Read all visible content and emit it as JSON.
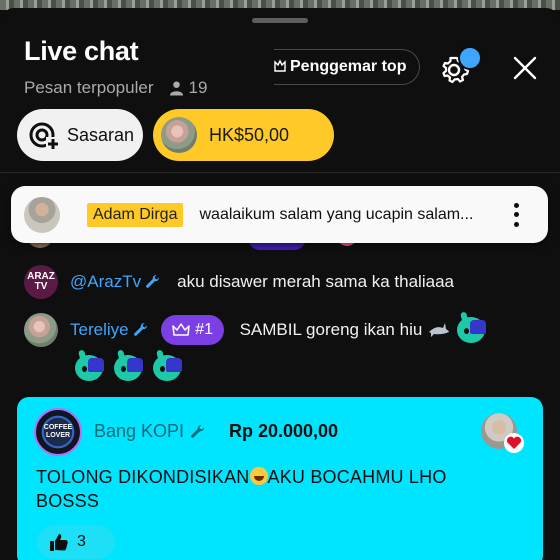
{
  "header": {
    "title": "Live chat",
    "mode": "Pesan terpopuler",
    "viewer_count": "19",
    "top_fans_label": "Penggemar top"
  },
  "chips": {
    "target_label": "Sasaran",
    "donation_amount": "HK$50,00"
  },
  "pinned": {
    "author": "Adam Dirga",
    "message": "waalaikum salam yang ucapin salam..."
  },
  "messages": [
    {
      "author": "@ArazTv",
      "avatar_text": [
        "ARAZ",
        "TV"
      ],
      "text": "aku disawer merah sama ka thaliaaa"
    },
    {
      "author": "Tereliye",
      "rank": "#1",
      "text": "SAMBIL goreng ikan hiu"
    }
  ],
  "super_chat": {
    "author": "Bang KOPI",
    "avatar_text": "COFFEE LOVER",
    "amount": "Rp 20.000,00",
    "text_part1": "TOLONG DIKONDISIKAN",
    "text_part2": "AKU BOCAHMU LHO BOSSS",
    "likes": "3",
    "background_color": "#00e5ff"
  },
  "colors": {
    "accent_blue": "#3ea6ff",
    "donation_yellow": "#ffca28",
    "rank_purple": "#7b3fe4"
  },
  "icons": [
    "viewer-icon",
    "crown-icon",
    "settings-icon",
    "close-icon",
    "target-add-icon",
    "wrench-icon",
    "more-vert-icon",
    "shark-icon",
    "like-icon",
    "heart-icon",
    "emoji-icon",
    "laugh-emoji-icon"
  ]
}
